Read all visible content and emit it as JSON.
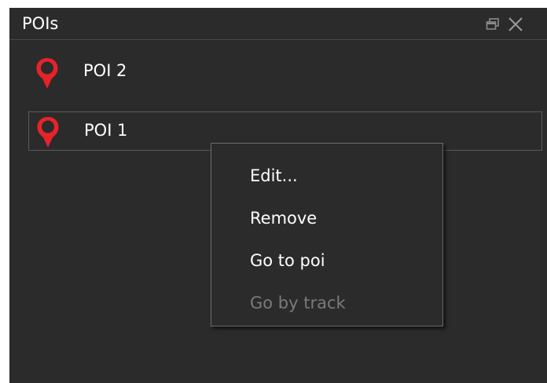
{
  "panel": {
    "title": "POIs",
    "icons": [
      "float-window-icon",
      "close-icon"
    ]
  },
  "poi_list": {
    "items": [
      {
        "label": "POI 2",
        "icon": "map-pin-icon",
        "selected": false
      },
      {
        "label": "POI 1",
        "icon": "map-pin-icon",
        "selected": true
      }
    ]
  },
  "context_menu": {
    "items": [
      {
        "label": "Edit...",
        "enabled": true
      },
      {
        "label": "Remove",
        "enabled": true
      },
      {
        "label": "Go to poi",
        "enabled": true
      },
      {
        "label": "Go by track",
        "enabled": false
      }
    ]
  },
  "colors": {
    "background": "#2b2b2b",
    "pin_red": "#e8222a",
    "text": "#ffffff",
    "disabled_text": "#7a7a7a"
  }
}
